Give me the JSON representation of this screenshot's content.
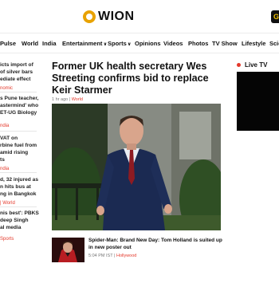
{
  "header": {
    "logo_text": "WION",
    "corner_tile_text": "G"
  },
  "nav": {
    "items": [
      {
        "label": "Pulse",
        "dropdown": false
      },
      {
        "label": "World",
        "dropdown": false
      },
      {
        "label": "India",
        "dropdown": false
      },
      {
        "label": "Entertainment",
        "dropdown": true
      },
      {
        "label": "Sports",
        "dropdown": true
      },
      {
        "label": "Opinions",
        "dropdown": false
      },
      {
        "label": "Videos",
        "dropdown": false
      },
      {
        "label": "Photos",
        "dropdown": false
      },
      {
        "label": "TV Show",
        "dropdown": false
      },
      {
        "label": "Lifestyle",
        "dropdown": false
      },
      {
        "label": "Scie",
        "dropdown": false
      }
    ]
  },
  "sidebar": {
    "items": [
      {
        "lines": [
          "icts import of",
          "of silver bars",
          "ediate effect"
        ],
        "category": "nomic"
      },
      {
        "lines": [
          "s Pune teacher,",
          "astermind' who",
          "ET-UG Biology"
        ],
        "category": "ndia"
      },
      {
        "lines": [
          "VAT on",
          "rbine fuel from",
          "amid rising",
          "ts"
        ],
        "category": "ndia"
      },
      {
        "lines": [
          "d, 32 injured as",
          "n hits bus at",
          "ng in Bangkok"
        ],
        "category": "| World"
      },
      {
        "lines": [
          "nis best': PBKS",
          "deep Singh",
          "al media"
        ],
        "category": "Sports"
      }
    ]
  },
  "main_story": {
    "headline": "Former UK health secretary Wes Streeting confirms bid to replace Keir Starmer",
    "time": "1 hr ago",
    "separator": "|",
    "category": "World"
  },
  "secondary_story": {
    "title": "Spider-Man: Brand New Day: Tom Holland is suited up in new poster out",
    "time": "5:04 PM IST",
    "separator": "|",
    "category": "Hollywood"
  },
  "live_tv": {
    "label": "Live TV"
  },
  "colors": {
    "accent_red": "#e4392b",
    "logo_orange": "#e8a200"
  }
}
